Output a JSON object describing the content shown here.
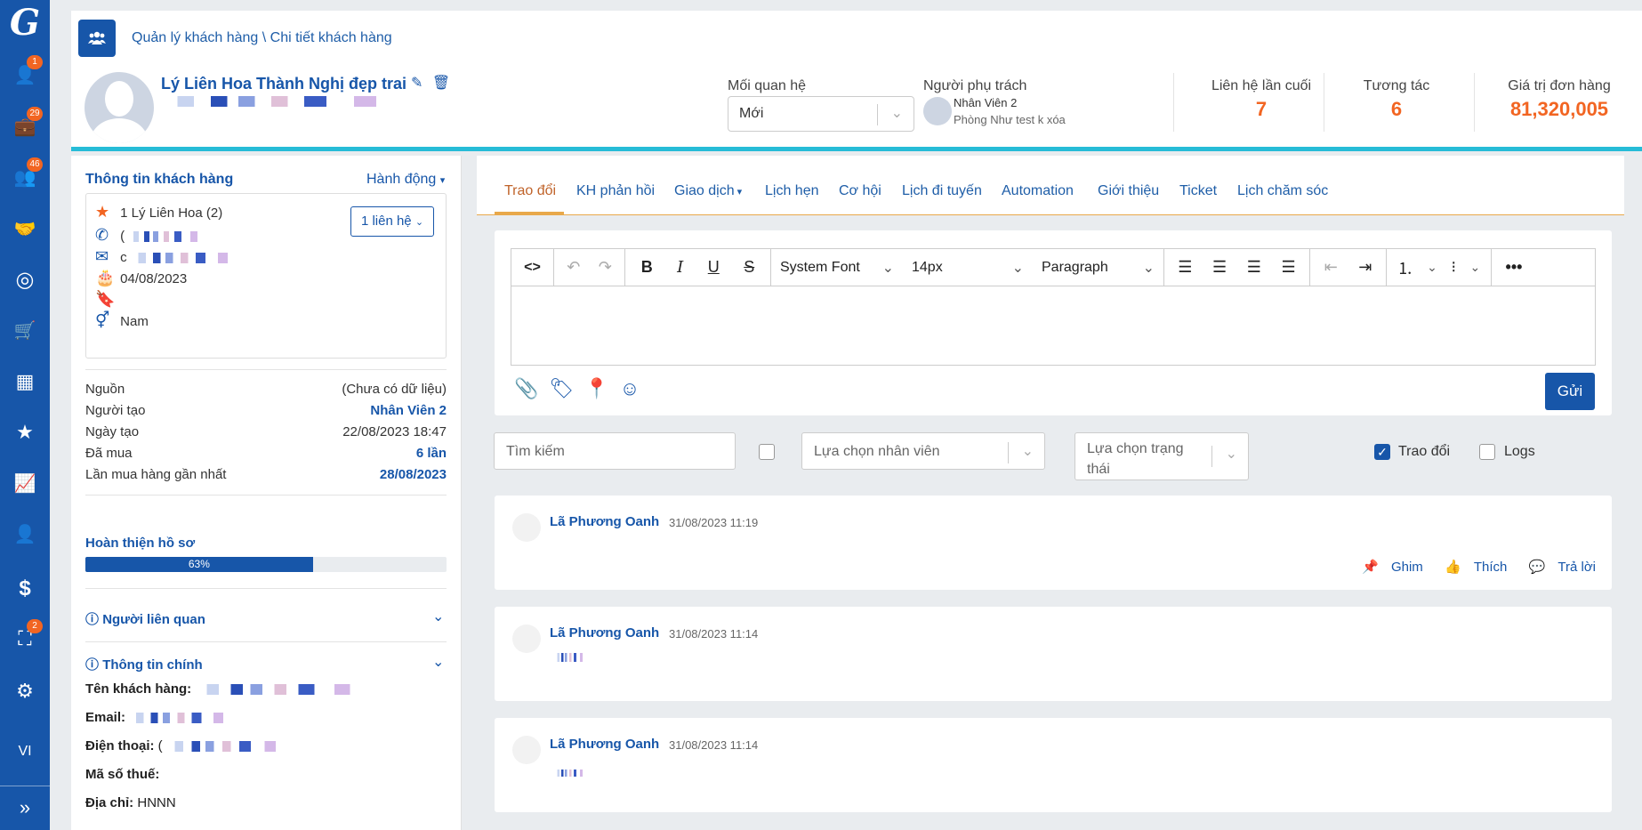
{
  "nav": {
    "logo": "G",
    "items": [
      {
        "icon": "user-icon",
        "glyph": "👤",
        "badge": "1"
      },
      {
        "icon": "briefcase-icon",
        "glyph": "💼",
        "badge": "29"
      },
      {
        "icon": "users-icon",
        "glyph": "👥",
        "badge": "46"
      },
      {
        "icon": "handshake-icon",
        "glyph": "🤝",
        "badge": ""
      },
      {
        "icon": "target-icon",
        "glyph": "◎",
        "badge": ""
      },
      {
        "icon": "cart-icon",
        "glyph": "🛒",
        "badge": ""
      },
      {
        "icon": "cubes-icon",
        "glyph": "▦",
        "badge": ""
      },
      {
        "icon": "star-icon",
        "glyph": "★",
        "badge": ""
      },
      {
        "icon": "chart-icon",
        "glyph": "📈",
        "badge": ""
      },
      {
        "icon": "user-tie-icon",
        "glyph": "👤",
        "badge": ""
      },
      {
        "icon": "dollar-icon",
        "glyph": "$",
        "badge": ""
      },
      {
        "icon": "org-chart-icon",
        "glyph": "⛶",
        "badge": "2"
      },
      {
        "icon": "gear-icon",
        "glyph": "⚙",
        "badge": ""
      }
    ],
    "language": "VI",
    "expand_glyph": "»"
  },
  "header": {
    "breadcrumb": "Quản lý khách hàng \\ Chi tiết khách hàng",
    "customer_name": "Lý Liên Hoa Thành Nghị đẹp trai",
    "relationship_label": "Mối quan hệ",
    "relationship_value": "Mới",
    "owner_label": "Người phụ trách",
    "owner_name": "Nhân Viên 2",
    "owner_dept": "Phòng Như test k xóa",
    "stats": [
      {
        "label": "Liên hệ lần cuối",
        "value": "7"
      },
      {
        "label": "Tương tác",
        "value": "6"
      },
      {
        "label": "Giá trị đơn hàng",
        "value": "81,320,005"
      }
    ]
  },
  "customer_info": {
    "title": "Thông tin khách hàng",
    "action_label": "Hành động",
    "contact_name": "1 Lý Liên Hoa (2)",
    "contact_button": "1 liên hệ",
    "phone_prefix": "(",
    "email_prefix": "c",
    "birthday": "04/08/2023",
    "gender": "Nam",
    "fields": [
      {
        "key": "Nguồn",
        "value": "(Chưa có dữ liệu)",
        "strong": false
      },
      {
        "key": "Người tạo",
        "value": "Nhân Viên 2",
        "strong": true
      },
      {
        "key": "Ngày tạo",
        "value": "22/08/2023 18:47",
        "strong": false
      },
      {
        "key": "Đã mua",
        "value": "6 lần",
        "strong": true
      },
      {
        "key": "Lần mua hàng gần nhất",
        "value": "28/08/2023",
        "strong": true
      }
    ],
    "profile_label": "Hoàn thiện hồ sơ",
    "profile_percent": 63,
    "profile_text": "63%",
    "related_title": "Người liên quan",
    "main_info_title": "Thông tin chính",
    "details": [
      {
        "label": "Tên khách hàng:",
        "value": ""
      },
      {
        "label": "Email:",
        "value": ""
      },
      {
        "label": "Điện thoại:",
        "value": "("
      },
      {
        "label": "Mã số thuế:",
        "value": ""
      },
      {
        "label": "Địa chỉ:",
        "value": "HNNN"
      }
    ]
  },
  "tabs": [
    "Trao đổi",
    "KH phản hồi",
    "Giao dịch",
    "Lịch hẹn",
    "Cơ hội",
    "Lịch đi tuyến",
    "Automation",
    "Giới thiệu",
    "Ticket",
    "Lịch chăm sóc"
  ],
  "editor": {
    "font": "System Font",
    "size": "14px",
    "format": "Paragraph",
    "send_label": "Gửi"
  },
  "filters": {
    "search_placeholder": "Tìm kiếm",
    "staff_placeholder": "Lựa chọn nhân viên",
    "status_placeholder": "Lựa chọn trạng thái",
    "exchange_label": "Trao đổi",
    "logs_label": "Logs"
  },
  "messages": [
    {
      "author": "Lã Phương Oanh",
      "time": "31/08/2023 11:19",
      "actions": [
        "Ghim",
        "Thích",
        "Trả lời"
      ]
    },
    {
      "author": "Lã Phương Oanh",
      "time": "31/08/2023 11:14"
    },
    {
      "author": "Lã Phương Oanh",
      "time": "31/08/2023 11:14"
    }
  ],
  "colors": {
    "primary": "#1756a9",
    "accent": "#f26522",
    "cyan_line": "#26bcd7"
  }
}
